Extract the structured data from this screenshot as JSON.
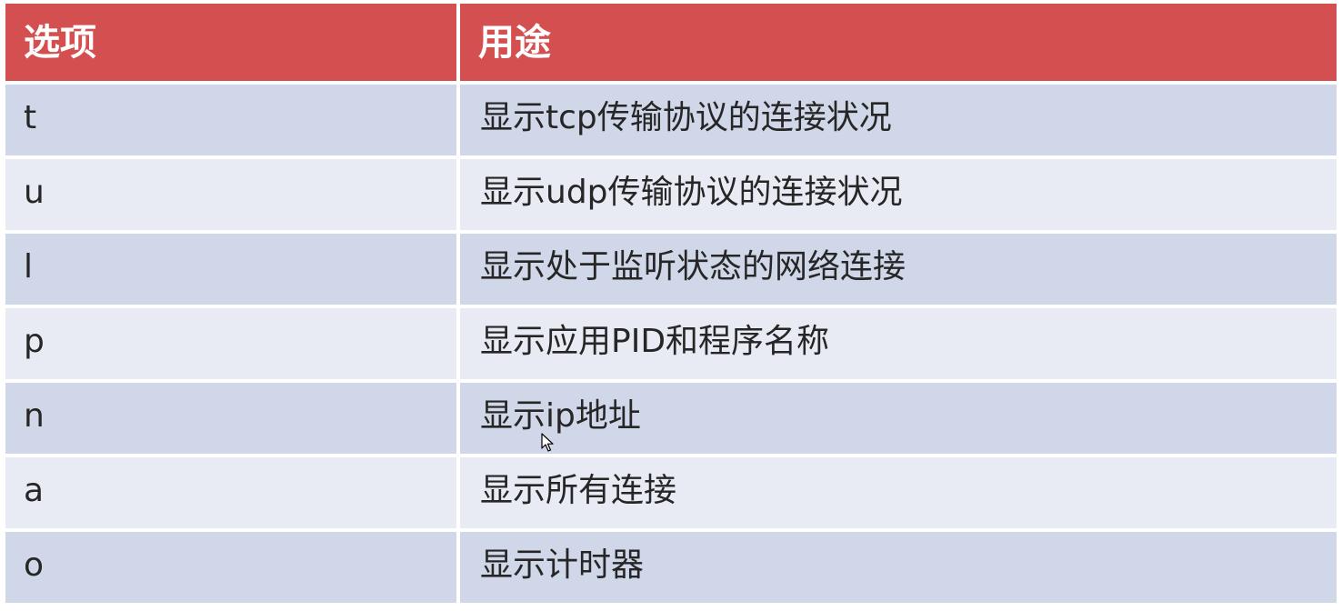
{
  "table": {
    "headers": [
      "选项",
      "用途"
    ],
    "rows": [
      {
        "option": "t",
        "usage": "显示tcp传输协议的连接状况"
      },
      {
        "option": "u",
        "usage": "显示udp传输协议的连接状况"
      },
      {
        "option": "l",
        "usage": "显示处于监听状态的网络连接"
      },
      {
        "option": "p",
        "usage": "显示应用PID和程序名称"
      },
      {
        "option": "n",
        "usage": "显示ip地址"
      },
      {
        "option": "a",
        "usage": "显示所有连接"
      },
      {
        "option": "o",
        "usage": "显示计时器"
      }
    ]
  },
  "colors": {
    "header_bg": "#d44f4f",
    "header_text": "#ffffff",
    "row_odd_bg": "#cfd7e8",
    "row_even_bg": "#e8ebf4",
    "body_text": "#262626"
  },
  "icons": [
    "mouse-pointer-icon"
  ]
}
